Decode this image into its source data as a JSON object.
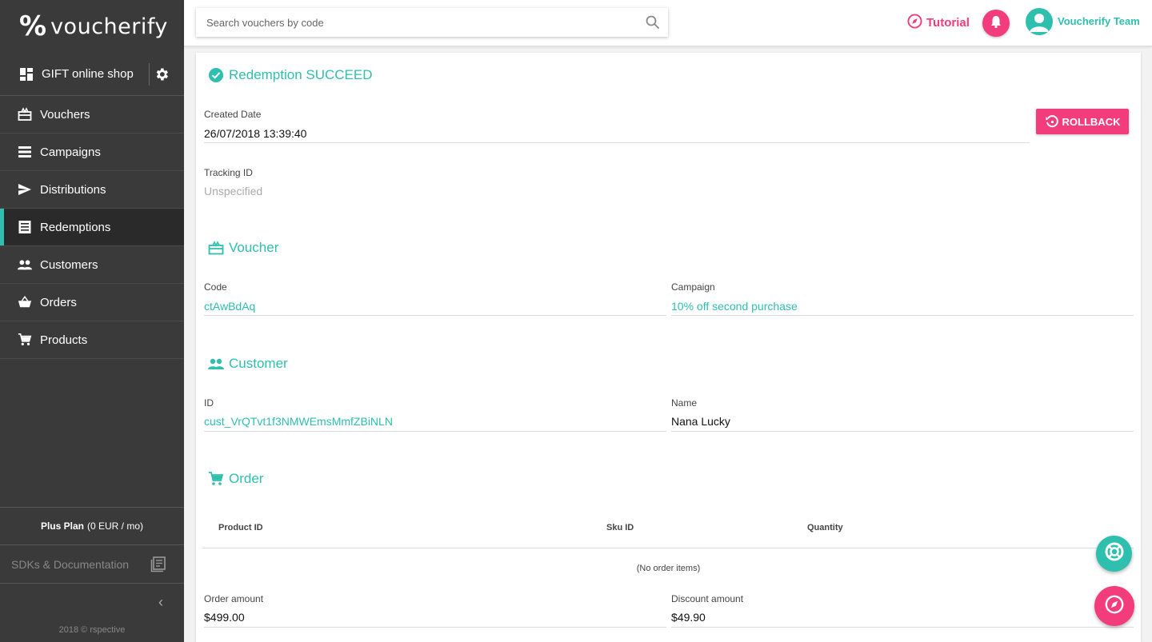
{
  "brand": {
    "logo_mark": "%",
    "logo_text": "voucherify"
  },
  "project": {
    "name": "GIFT online shop"
  },
  "nav": [
    {
      "label": "Vouchers",
      "icon": "gift-icon"
    },
    {
      "label": "Campaigns",
      "icon": "list-icon"
    },
    {
      "label": "Distributions",
      "icon": "send-icon"
    },
    {
      "label": "Redemptions",
      "icon": "receipt-icon",
      "active": true
    },
    {
      "label": "Customers",
      "icon": "people-icon"
    },
    {
      "label": "Orders",
      "icon": "basket-icon"
    },
    {
      "label": "Products",
      "icon": "cart-icon"
    }
  ],
  "plan": {
    "name": "Plus Plan",
    "price": "(0 EUR / mo)"
  },
  "sdk": {
    "label": "SDKs & Documentation"
  },
  "collapse": {
    "glyph": "‹"
  },
  "copyright": "2018 © rspective",
  "topbar": {
    "search_placeholder": "Search vouchers by code",
    "tutorial": "Tutorial",
    "team": "Voucherify Team"
  },
  "redemption": {
    "title": "Redemption SUCCEED",
    "created_label": "Created Date",
    "created_value": "26/07/2018 13:39:40",
    "tracking_label": "Tracking ID",
    "tracking_value": "Unspecified",
    "rollback": "ROLLBACK"
  },
  "voucher": {
    "title": "Voucher",
    "code_label": "Code",
    "code_value": "ctAwBdAq",
    "campaign_label": "Campaign",
    "campaign_value": "10% off second purchase"
  },
  "customer": {
    "title": "Customer",
    "id_label": "ID",
    "id_value": "cust_VrQTvt1f3NMWEmsMmfZBiNLN",
    "name_label": "Name",
    "name_value": "Nana Lucky"
  },
  "order": {
    "title": "Order",
    "columns": [
      "Product ID",
      "Sku ID",
      "Quantity"
    ],
    "empty": "(No order items)",
    "amount_label": "Order amount",
    "amount_value": "$499.00",
    "discount_label": "Discount amount",
    "discount_value": "$49.90"
  },
  "colors": {
    "accent": "#2ebfae",
    "brand_pink": "#f23c7b",
    "sidebar": "#3a3a3a"
  }
}
